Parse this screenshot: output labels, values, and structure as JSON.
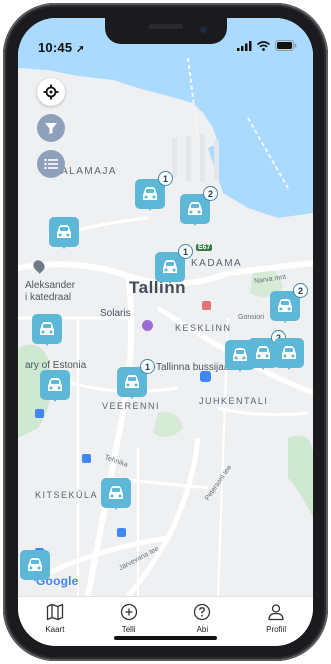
{
  "status_bar": {
    "time": "10:45"
  },
  "map": {
    "city_label": "Tallinn",
    "district_labels": [
      "ALAMAJA",
      "KADAMA",
      "KESKLINN",
      "VEERENNI",
      "JUHKENTALI",
      "KITSEKÜLA"
    ],
    "poi_labels": [
      "Aleksander",
      "i katedraal",
      "ary of Estonia",
      "Solaris",
      "Tallinna bussijaa"
    ],
    "street_labels": [
      "Petersoni tee",
      "Järvevana tee",
      "Narva mnt",
      "Gonsiori",
      "Tehnika"
    ],
    "attribution": "Google",
    "road_badge": "E67"
  },
  "markers": [
    {
      "count": "1"
    },
    {
      "count": "2"
    },
    {
      "count": ""
    },
    {
      "count": "1"
    },
    {
      "count": "2"
    },
    {
      "count": ""
    },
    {
      "count": "2"
    },
    {
      "count": ""
    },
    {
      "count": "1"
    },
    {
      "count": ""
    },
    {
      "count": ""
    }
  ],
  "tabbar": {
    "items": [
      {
        "label": "Kaart",
        "icon": "map-icon"
      },
      {
        "label": "Telli",
        "icon": "plus-circle-icon"
      },
      {
        "label": "Abi",
        "icon": "help-circle-icon"
      },
      {
        "label": "Profiil",
        "icon": "user-icon"
      }
    ]
  },
  "colors": {
    "marker": "#5cb8d6",
    "water": "#aadaff",
    "land": "#eef0f2",
    "park": "#c8e6c9"
  }
}
